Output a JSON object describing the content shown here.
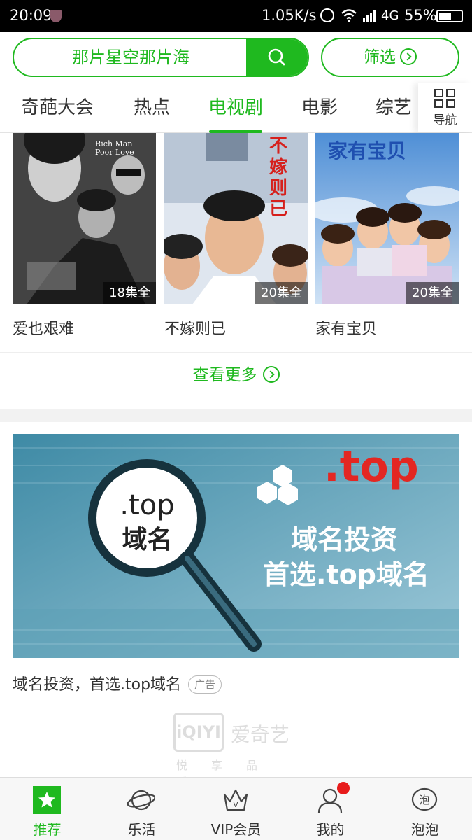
{
  "status_bar": {
    "time": "20:09",
    "network_speed": "1.05K/s",
    "network_type": "4G",
    "battery_percent": "55%",
    "battery_level": 0.55
  },
  "search": {
    "query": "那片星空那片海",
    "filter_label": "筛选"
  },
  "tabs": {
    "items": [
      "奇葩大会",
      "热点",
      "电视剧",
      "电影",
      "综艺"
    ],
    "active_index": 2,
    "nav_label": "导航"
  },
  "shows": [
    {
      "title": "爱也艰难",
      "episodes": "18集全",
      "poster_text": "Rich Man Poor Love"
    },
    {
      "title": "不嫁则已",
      "episodes": "20集全",
      "poster_text": "不嫁则已"
    },
    {
      "title": "家有宝贝",
      "episodes": "20集全",
      "poster_text": "家有宝贝"
    }
  ],
  "more_label": "查看更多",
  "ad": {
    "banner_line1": "域名投资",
    "banner_line2": "首选.top域名",
    "badge_top": ".top",
    "magnifier_line1": ".top",
    "magnifier_line2": "域名",
    "text": "域名投资，首选.top域名",
    "tag": "广告"
  },
  "brand": {
    "logo": "iQIYI",
    "name": "爱奇艺",
    "slogan": "悦享品质"
  },
  "bottom_nav": {
    "items": [
      "推荐",
      "乐活",
      "VIP会员",
      "我的",
      "泡泡"
    ],
    "active_index": 0
  },
  "colors": {
    "accent": "#1fb91f",
    "notification_dot": "#e81c1c"
  }
}
